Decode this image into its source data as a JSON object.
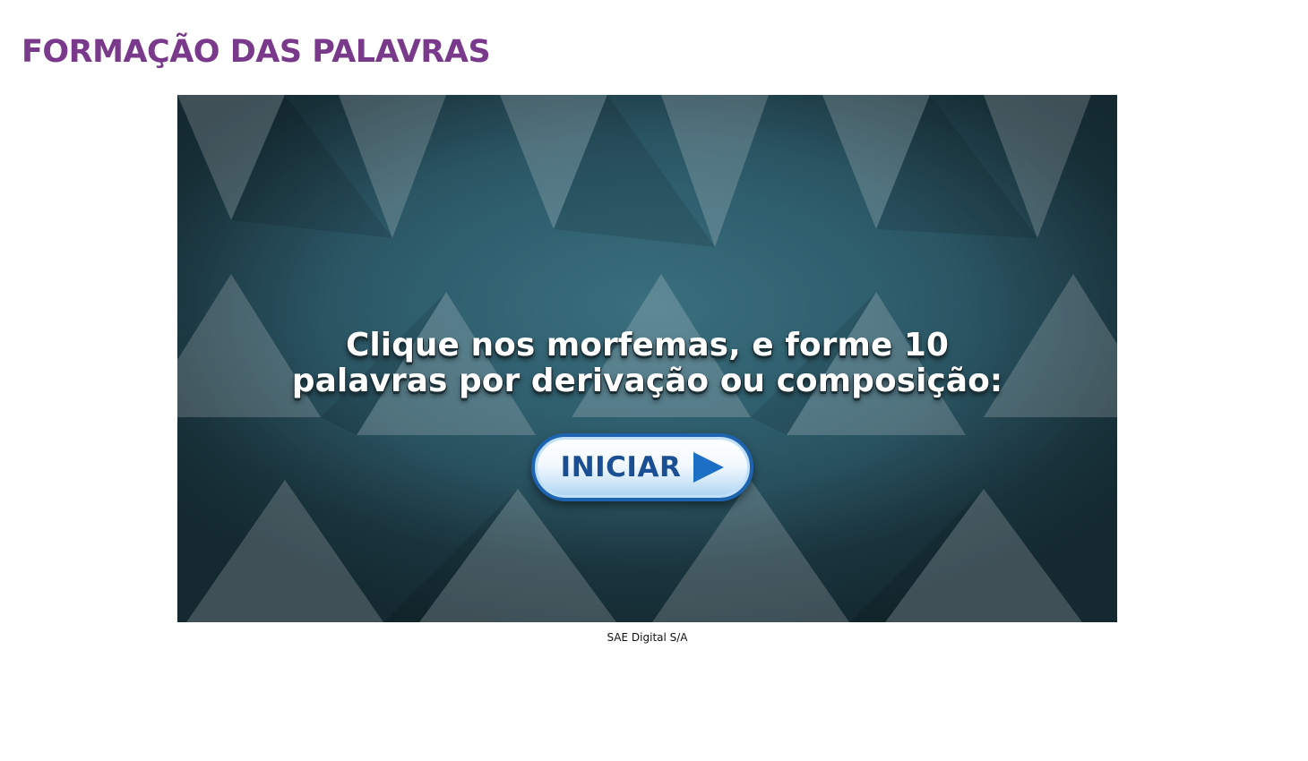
{
  "page": {
    "title": "FORMAÇÃO DAS PALAVRAS",
    "title_color": "#7a3a8c"
  },
  "game": {
    "instruction_line_1": "Clique nos morfemas, e forme 10",
    "instruction_line_2": "palavras por derivação ou composição:",
    "start_button_label": "INICIAR",
    "start_button_icon": "play-arrow-icon",
    "background_color": "#2f5e6d",
    "accent_color": "#1e63b0"
  },
  "footer": {
    "caption": "SAE Digital S/A"
  }
}
